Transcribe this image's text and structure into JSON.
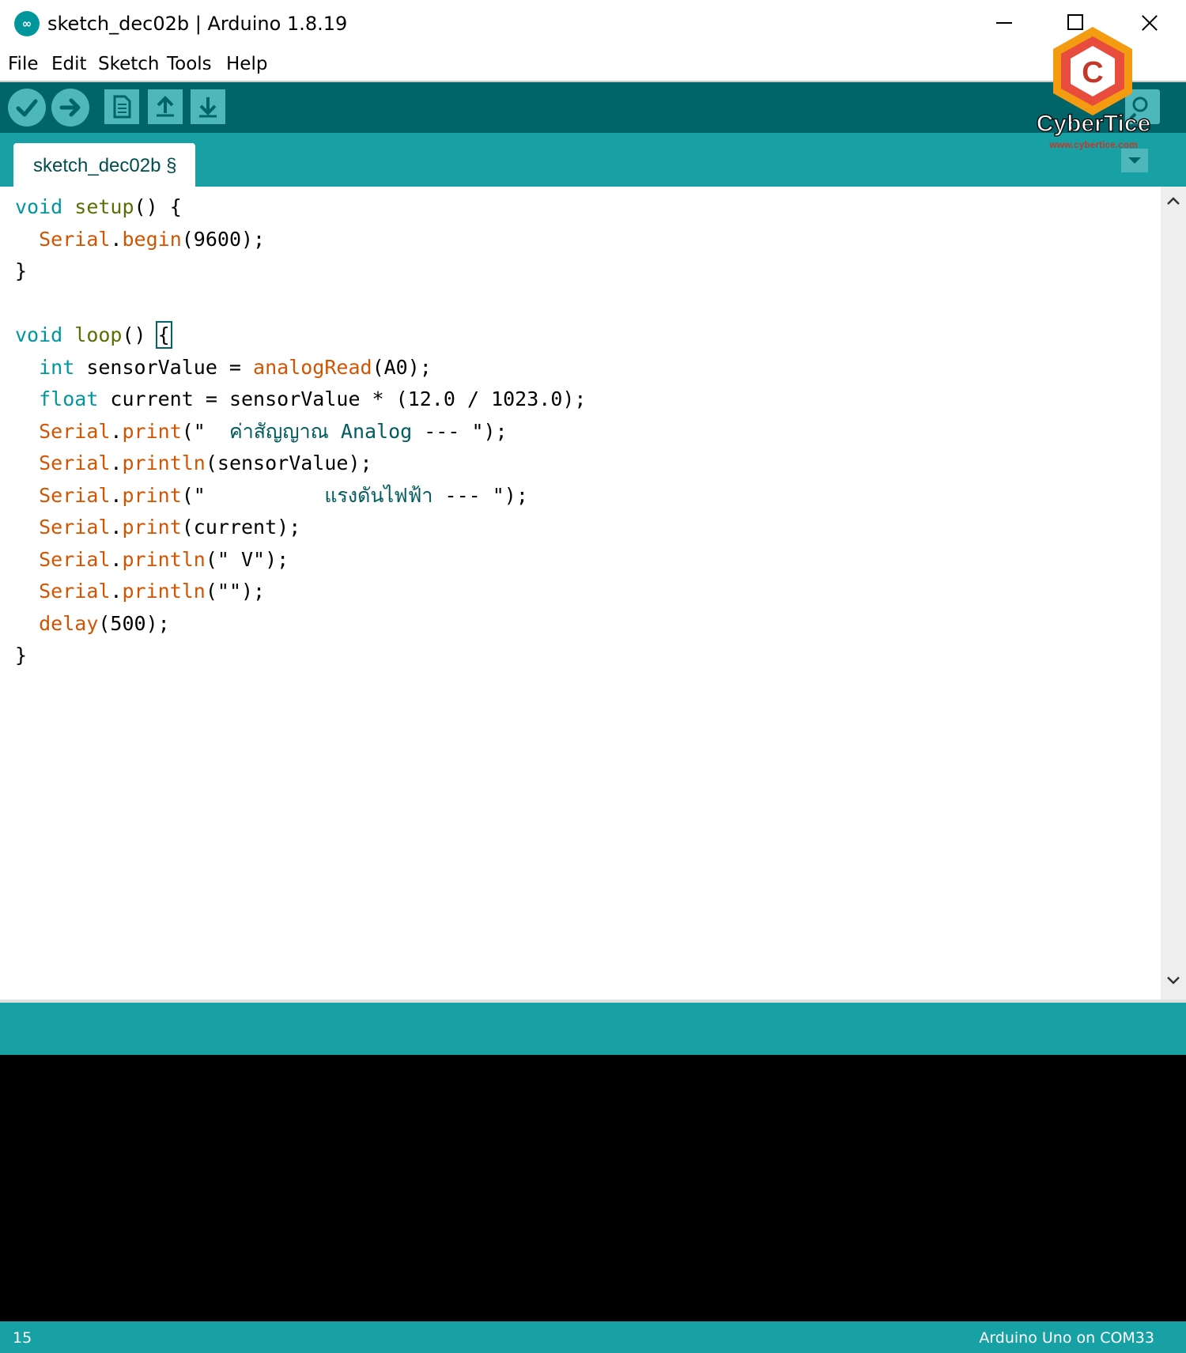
{
  "window": {
    "icon_glyph": "∞",
    "title": "sketch_dec02b | Arduino 1.8.19"
  },
  "menu": {
    "items": [
      {
        "label": "File"
      },
      {
        "label": "Edit"
      },
      {
        "label": "Sketch"
      },
      {
        "label": "Tools"
      },
      {
        "label": "Help"
      }
    ]
  },
  "toolbar": {
    "buttons": [
      "verify",
      "upload",
      "new",
      "open",
      "save",
      "serial-monitor"
    ]
  },
  "tabs": [
    {
      "label": "sketch_dec02b §",
      "active": true
    }
  ],
  "editor": {
    "lines": [
      "void setup() {",
      "  Serial.begin(9600);",
      "}",
      "",
      "void loop() {",
      "  int sensorValue = analogRead(A0);",
      "  float current = sensorValue * (12.0 / 1023.0);",
      "  Serial.print(\"  ค่าสัญญาณ Analog --- \");",
      "  Serial.println(sensorValue);",
      "  Serial.print(\"          แรงดันไฟฟ้า --- \");",
      "  Serial.print(current);",
      "  Serial.println(\" V\");",
      "  Serial.println(\"\");",
      "  delay(500);",
      "}"
    ],
    "cursor_line": 5
  },
  "status": {
    "line_number": "15",
    "board": "Arduino Uno on COM33"
  },
  "watermark": {
    "logo_letter": "C",
    "name": "CyberTice",
    "url": "www.cybertice.com"
  },
  "colors": {
    "toolbar": "#006468",
    "teal": "#17a1a5",
    "button": "#4db7bb",
    "keyword": "#00979c",
    "function": "#d35400",
    "console": "#000000"
  }
}
